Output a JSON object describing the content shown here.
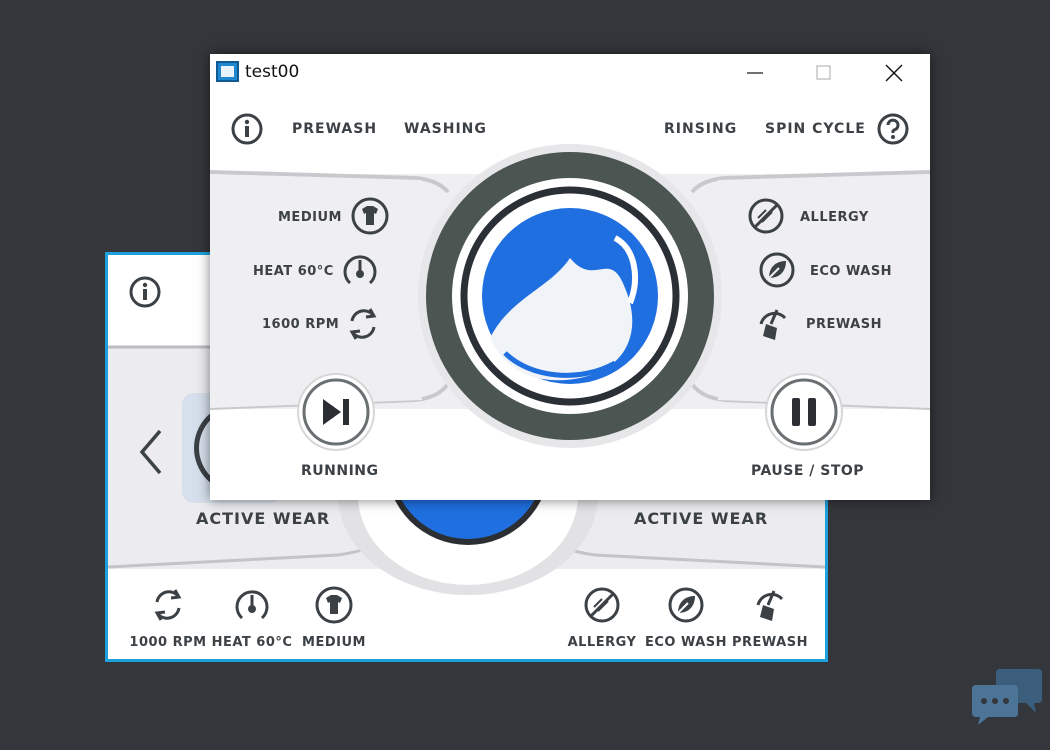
{
  "front": {
    "title": "test00",
    "steps": [
      "PREWASH",
      "WASHING",
      "RINSING",
      "SPIN CYCLE"
    ],
    "left_options": [
      "MEDIUM",
      "HEAT 60°C",
      "1600 RPM"
    ],
    "right_options": [
      "ALLERGY",
      "ECO WASH",
      "PREWASH"
    ],
    "run_label": "RUNNING",
    "pause_label": "PAUSE / STOP"
  },
  "back": {
    "program_left": "ACTIVE WEAR",
    "program_right": "ACTIVE WEAR",
    "bottom_left": [
      "1000 RPM",
      "HEAT 60°C",
      "MEDIUM"
    ],
    "bottom_right": [
      "ALLERGY",
      "ECO WASH",
      "PREWASH"
    ]
  },
  "colors": {
    "accent_blue": "#1da1dc",
    "water_blue": "#1f6fe0",
    "ring_dark": "#48524f",
    "text_dark": "#3c4146"
  }
}
